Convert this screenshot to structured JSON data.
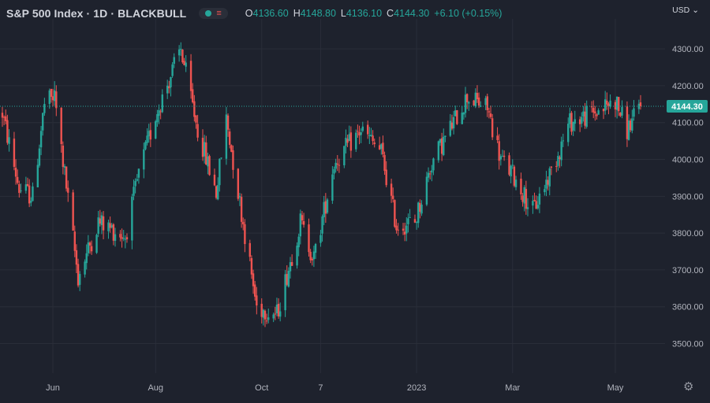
{
  "header": {
    "title": "S&P 500 Index · 1D · BLACKBULL",
    "ohlc": [
      {
        "key": "O",
        "value": "4136.60"
      },
      {
        "key": "H",
        "value": "4148.80"
      },
      {
        "key": "L",
        "value": "4136.10"
      },
      {
        "key": "C",
        "value": "4144.30"
      },
      {
        "key": "",
        "value": "+6.10 (+0.15%)"
      }
    ]
  },
  "currency": "USD",
  "colors": {
    "up": "#26a69a",
    "down": "#ef5350",
    "background": "#1e222d",
    "grid": "#2a2e39",
    "text": "#d1d4dc"
  },
  "chart_data": {
    "type": "candlestick",
    "symbol": "S&P 500 Index",
    "interval": "1D",
    "source": "BLACKBULL",
    "ylim": [
      3420,
      4360
    ],
    "y_ticks": [
      "4300.00",
      "4200.00",
      "4100.00",
      "4000.00",
      "3900.00",
      "3800.00",
      "3700.00",
      "3600.00",
      "3500.00"
    ],
    "x_ticks": [
      {
        "label": "Jun",
        "date": "2022-06-01"
      },
      {
        "label": "Aug",
        "date": "2022-08-01"
      },
      {
        "label": "Oct",
        "date": "2022-10-03"
      },
      {
        "label": "7",
        "date": "2022-11-07"
      },
      {
        "label": "2023",
        "date": "2023-01-03"
      },
      {
        "label": "Mar",
        "date": "2023-03-01"
      },
      {
        "label": "May",
        "date": "2023-05-01"
      }
    ],
    "last_price": "4144.30",
    "last_price_value": 4144.3,
    "waypoints": [
      [
        "2022-05-02",
        4125
      ],
      [
        "2022-05-12",
        3920
      ],
      [
        "2022-05-20",
        3900
      ],
      [
        "2022-05-27",
        4150
      ],
      [
        "2022-06-02",
        4170
      ],
      [
        "2022-06-16",
        3680
      ],
      [
        "2022-06-28",
        3830
      ],
      [
        "2022-07-14",
        3790
      ],
      [
        "2022-07-22",
        3960
      ],
      [
        "2022-08-01",
        4120
      ],
      [
        "2022-08-16",
        4300
      ],
      [
        "2022-08-26",
        4080
      ],
      [
        "2022-09-06",
        3910
      ],
      [
        "2022-09-12",
        4110
      ],
      [
        "2022-09-30",
        3600
      ],
      [
        "2022-10-12",
        3580
      ],
      [
        "2022-10-26",
        3830
      ],
      [
        "2022-11-03",
        3730
      ],
      [
        "2022-11-15",
        3990
      ],
      [
        "2022-12-01",
        4080
      ],
      [
        "2022-12-13",
        4020
      ],
      [
        "2022-12-22",
        3820
      ],
      [
        "2023-01-02",
        3830
      ],
      [
        "2023-01-12",
        3990
      ],
      [
        "2023-02-02",
        4170
      ],
      [
        "2023-02-14",
        4140
      ],
      [
        "2023-02-22",
        4000
      ],
      [
        "2023-03-01",
        3960
      ],
      [
        "2023-03-13",
        3860
      ],
      [
        "2023-03-24",
        3970
      ],
      [
        "2023-04-04",
        4100
      ],
      [
        "2023-04-20",
        4130
      ],
      [
        "2023-05-01",
        4160
      ],
      [
        "2023-05-08",
        4080
      ],
      [
        "2023-05-16",
        4144.3
      ]
    ]
  }
}
